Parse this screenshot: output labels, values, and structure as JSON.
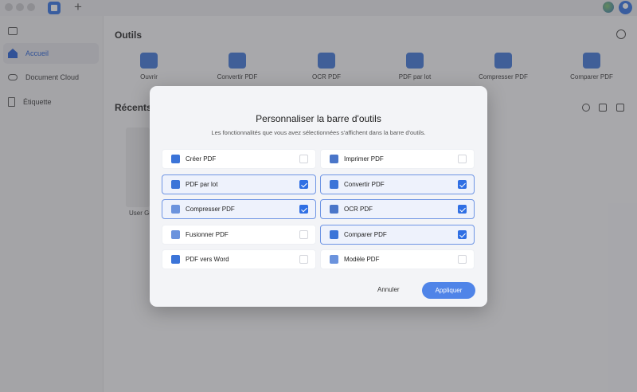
{
  "sidebar": {
    "items": [
      {
        "label": "Accueil"
      },
      {
        "label": "Document Cloud"
      },
      {
        "label": "Étiquette"
      }
    ]
  },
  "main": {
    "tools_title": "Outils",
    "recent_title": "Récents",
    "tools": [
      {
        "label": "Ouvrir",
        "icon": "folder-icon"
      },
      {
        "label": "Convertir PDF",
        "icon": "convert-icon"
      },
      {
        "label": "OCR PDF",
        "icon": "ocr-icon"
      },
      {
        "label": "PDF par lot",
        "icon": "batch-icon"
      },
      {
        "label": "Compresser PDF",
        "icon": "compress-icon"
      },
      {
        "label": "Comparer PDF",
        "icon": "compare-icon"
      }
    ],
    "recent_file_label": "User Gu"
  },
  "dialog": {
    "title": "Personnaliser la barre d'outils",
    "subtitle": "Les fonctionnalités que vous avez sélectionnées s'affichent dans la barre d'outils.",
    "options": [
      {
        "label": "Créer PDF",
        "checked": false,
        "icon": "create-pdf-icon",
        "color": "#3b74d8"
      },
      {
        "label": "Imprimer PDF",
        "checked": false,
        "icon": "print-icon",
        "color": "#4a76c9"
      },
      {
        "label": "PDF par lot",
        "checked": true,
        "icon": "batch-icon",
        "color": "#3b74d8"
      },
      {
        "label": "Convertir PDF",
        "checked": true,
        "icon": "convert-icon",
        "color": "#3b74d8"
      },
      {
        "label": "Compresser PDF",
        "checked": true,
        "icon": "compress-icon",
        "color": "#6b93dd"
      },
      {
        "label": "OCR PDF",
        "checked": true,
        "icon": "ocr-icon",
        "color": "#4a76c9"
      },
      {
        "label": "Fusionner PDF",
        "checked": false,
        "icon": "merge-icon",
        "color": "#6b93dd"
      },
      {
        "label": "Comparer PDF",
        "checked": true,
        "icon": "compare-icon",
        "color": "#3b74d8"
      },
      {
        "label": "PDF vers Word",
        "checked": false,
        "icon": "word-icon",
        "color": "#3b74d8"
      },
      {
        "label": "Modèle PDF",
        "checked": false,
        "icon": "template-icon",
        "color": "#6b93dd"
      }
    ],
    "cancel_label": "Annuler",
    "apply_label": "Appliquer"
  },
  "colors": {
    "accent": "#2f6fe4",
    "apply_button": "#4f84e8",
    "selected_border": "#6f95e4"
  }
}
